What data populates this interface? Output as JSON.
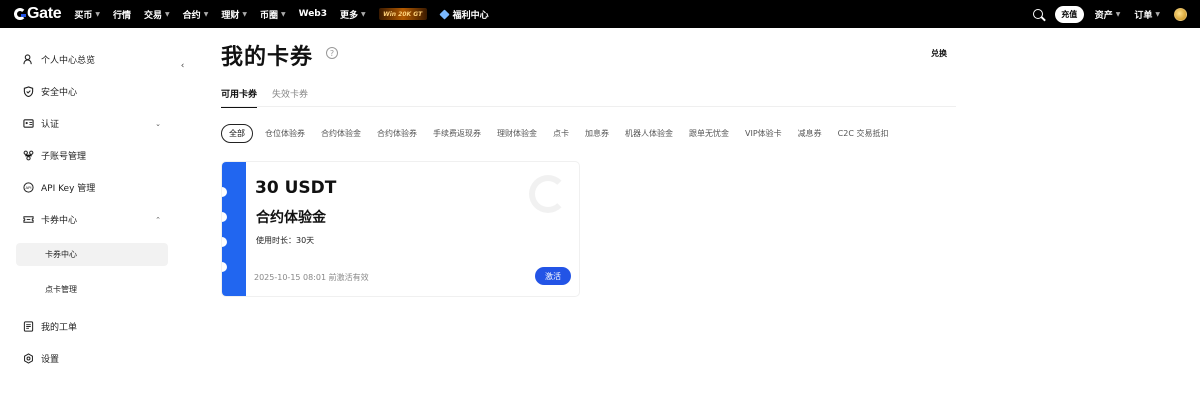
{
  "brand": {
    "name": "Gate"
  },
  "nav": {
    "items": [
      {
        "label": "买币",
        "caret": true
      },
      {
        "label": "行情",
        "caret": false
      },
      {
        "label": "交易",
        "caret": true
      },
      {
        "label": "合约",
        "caret": true
      },
      {
        "label": "理财",
        "caret": true
      },
      {
        "label": "币圈",
        "caret": true
      },
      {
        "label": "Web3",
        "caret": false
      },
      {
        "label": "更多",
        "caret": true
      }
    ],
    "promo": "Win 20K GT",
    "gift": "福利中心"
  },
  "top_right": {
    "deposit": "充值",
    "assets": "资产",
    "orders": "订单"
  },
  "sidebar": {
    "items": [
      {
        "label": "个人中心总览"
      },
      {
        "label": "安全中心"
      },
      {
        "label": "认证"
      },
      {
        "label": "子账号管理"
      },
      {
        "label": "API Key 管理"
      },
      {
        "label": "卡券中心"
      },
      {
        "label": "卡券中心"
      },
      {
        "label": "点卡管理"
      },
      {
        "label": "我的工单"
      },
      {
        "label": "设置"
      }
    ]
  },
  "main": {
    "title": "我的卡券",
    "redeem": "兑换",
    "tabs": [
      "可用卡券",
      "失效卡券"
    ],
    "filters": [
      "全部",
      "仓位体验券",
      "合约体验金",
      "合约体验券",
      "手续费返现券",
      "理财体验金",
      "点卡",
      "加息券",
      "机器人体验金",
      "跟单无忧金",
      "VIP体验卡",
      "减息券",
      "C2C 交易抵扣"
    ],
    "coupon": {
      "amount": "30 USDT",
      "name": "合约体验金",
      "duration": "使用时长：30天",
      "expiry": "2025-10-15 08:01 前激活有效",
      "activate": "激活"
    }
  },
  "colors": {
    "accent": "#2354e6",
    "strip": "#2166f0",
    "topbar": "#000000"
  }
}
